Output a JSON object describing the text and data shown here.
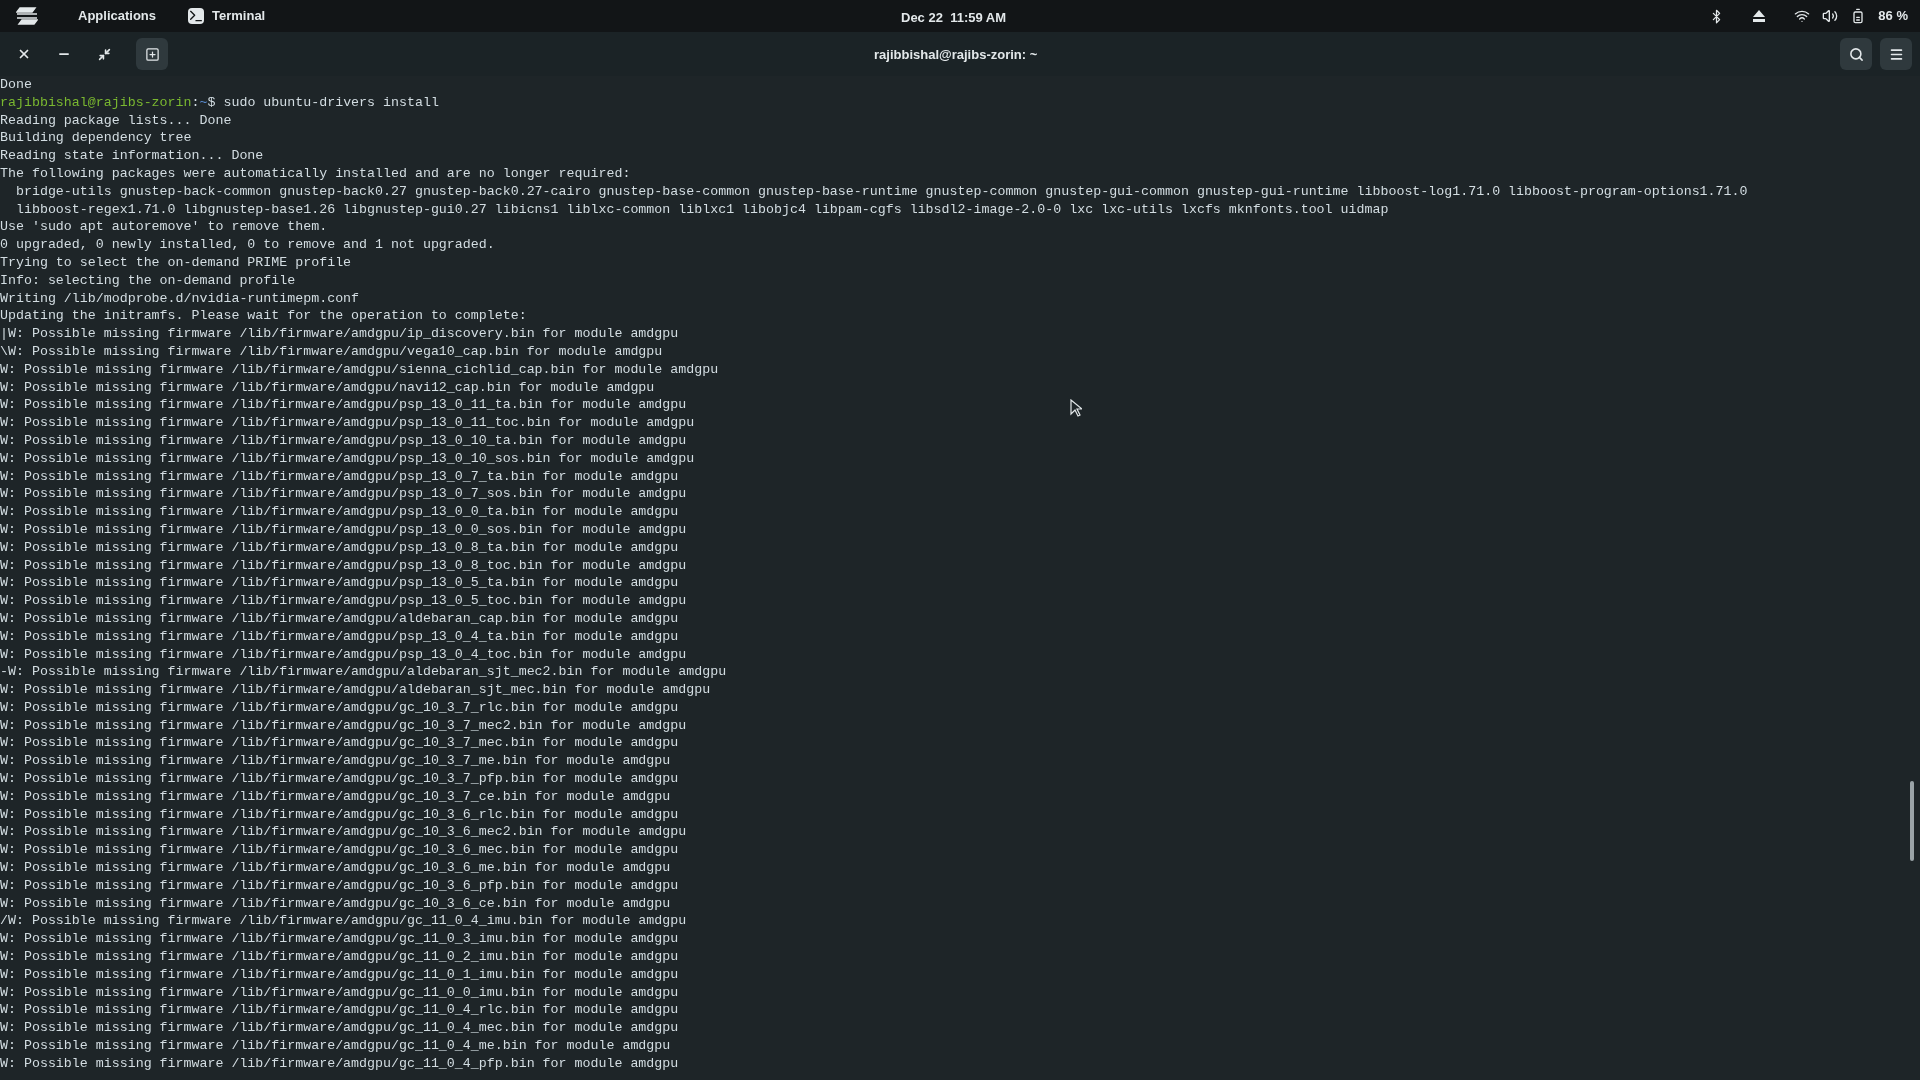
{
  "top_bar": {
    "menu": "Applications",
    "app": "Terminal",
    "clock": "Dec 22  11:59 AM",
    "battery": "86 %"
  },
  "window": {
    "title": "rajibbishal@rajibs-zorin: ~"
  },
  "terminal": {
    "lines": [
      {
        "kind": "output",
        "text": "Done"
      },
      {
        "kind": "prompt",
        "user_host": "rajibbishal@rajibs-zorin",
        "separator": ":",
        "path": "~",
        "command": "$ sudo ubuntu-drivers install"
      },
      {
        "kind": "output",
        "text": "Reading package lists... Done"
      },
      {
        "kind": "output",
        "text": "Building dependency tree"
      },
      {
        "kind": "output",
        "text": "Reading state information... Done"
      },
      {
        "kind": "output",
        "text": "The following packages were automatically installed and are no longer required:"
      },
      {
        "kind": "output",
        "text": "  bridge-utils gnustep-back-common gnustep-back0.27 gnustep-back0.27-cairo gnustep-base-common gnustep-base-runtime gnustep-common gnustep-gui-common gnustep-gui-runtime libboost-log1.71.0 libboost-program-options1.71.0"
      },
      {
        "kind": "output",
        "text": "  libboost-regex1.71.0 libgnustep-base1.26 libgnustep-gui0.27 libicns1 liblxc-common liblxc1 libobjc4 libpam-cgfs libsdl2-image-2.0-0 lxc lxc-utils lxcfs mknfonts.tool uidmap"
      },
      {
        "kind": "output",
        "text": "Use 'sudo apt autoremove' to remove them."
      },
      {
        "kind": "output",
        "text": "0 upgraded, 0 newly installed, 0 to remove and 1 not upgraded."
      },
      {
        "kind": "output",
        "text": "Trying to select the on-demand PRIME profile"
      },
      {
        "kind": "output",
        "text": "Info: selecting the on-demand profile"
      },
      {
        "kind": "output",
        "text": "Writing /lib/modprobe.d/nvidia-runtimepm.conf"
      },
      {
        "kind": "output",
        "text": "Updating the initramfs. Please wait for the operation to complete:"
      },
      {
        "kind": "output",
        "text": "|W: Possible missing firmware /lib/firmware/amdgpu/ip_discovery.bin for module amdgpu"
      },
      {
        "kind": "output",
        "text": "\\W: Possible missing firmware /lib/firmware/amdgpu/vega10_cap.bin for module amdgpu"
      },
      {
        "kind": "output",
        "text": "W: Possible missing firmware /lib/firmware/amdgpu/sienna_cichlid_cap.bin for module amdgpu"
      },
      {
        "kind": "output",
        "text": "W: Possible missing firmware /lib/firmware/amdgpu/navi12_cap.bin for module amdgpu"
      },
      {
        "kind": "output",
        "text": "W: Possible missing firmware /lib/firmware/amdgpu/psp_13_0_11_ta.bin for module amdgpu"
      },
      {
        "kind": "output",
        "text": "W: Possible missing firmware /lib/firmware/amdgpu/psp_13_0_11_toc.bin for module amdgpu"
      },
      {
        "kind": "output",
        "text": "W: Possible missing firmware /lib/firmware/amdgpu/psp_13_0_10_ta.bin for module amdgpu"
      },
      {
        "kind": "output",
        "text": "W: Possible missing firmware /lib/firmware/amdgpu/psp_13_0_10_sos.bin for module amdgpu"
      },
      {
        "kind": "output",
        "text": "W: Possible missing firmware /lib/firmware/amdgpu/psp_13_0_7_ta.bin for module amdgpu"
      },
      {
        "kind": "output",
        "text": "W: Possible missing firmware /lib/firmware/amdgpu/psp_13_0_7_sos.bin for module amdgpu"
      },
      {
        "kind": "output",
        "text": "W: Possible missing firmware /lib/firmware/amdgpu/psp_13_0_0_ta.bin for module amdgpu"
      },
      {
        "kind": "output",
        "text": "W: Possible missing firmware /lib/firmware/amdgpu/psp_13_0_0_sos.bin for module amdgpu"
      },
      {
        "kind": "output",
        "text": "W: Possible missing firmware /lib/firmware/amdgpu/psp_13_0_8_ta.bin for module amdgpu"
      },
      {
        "kind": "output",
        "text": "W: Possible missing firmware /lib/firmware/amdgpu/psp_13_0_8_toc.bin for module amdgpu"
      },
      {
        "kind": "output",
        "text": "W: Possible missing firmware /lib/firmware/amdgpu/psp_13_0_5_ta.bin for module amdgpu"
      },
      {
        "kind": "output",
        "text": "W: Possible missing firmware /lib/firmware/amdgpu/psp_13_0_5_toc.bin for module amdgpu"
      },
      {
        "kind": "output",
        "text": "W: Possible missing firmware /lib/firmware/amdgpu/aldebaran_cap.bin for module amdgpu"
      },
      {
        "kind": "output",
        "text": "W: Possible missing firmware /lib/firmware/amdgpu/psp_13_0_4_ta.bin for module amdgpu"
      },
      {
        "kind": "output",
        "text": "W: Possible missing firmware /lib/firmware/amdgpu/psp_13_0_4_toc.bin for module amdgpu"
      },
      {
        "kind": "output",
        "text": "-W: Possible missing firmware /lib/firmware/amdgpu/aldebaran_sjt_mec2.bin for module amdgpu"
      },
      {
        "kind": "output",
        "text": "W: Possible missing firmware /lib/firmware/amdgpu/aldebaran_sjt_mec.bin for module amdgpu"
      },
      {
        "kind": "output",
        "text": "W: Possible missing firmware /lib/firmware/amdgpu/gc_10_3_7_rlc.bin for module amdgpu"
      },
      {
        "kind": "output",
        "text": "W: Possible missing firmware /lib/firmware/amdgpu/gc_10_3_7_mec2.bin for module amdgpu"
      },
      {
        "kind": "output",
        "text": "W: Possible missing firmware /lib/firmware/amdgpu/gc_10_3_7_mec.bin for module amdgpu"
      },
      {
        "kind": "output",
        "text": "W: Possible missing firmware /lib/firmware/amdgpu/gc_10_3_7_me.bin for module amdgpu"
      },
      {
        "kind": "output",
        "text": "W: Possible missing firmware /lib/firmware/amdgpu/gc_10_3_7_pfp.bin for module amdgpu"
      },
      {
        "kind": "output",
        "text": "W: Possible missing firmware /lib/firmware/amdgpu/gc_10_3_7_ce.bin for module amdgpu"
      },
      {
        "kind": "output",
        "text": "W: Possible missing firmware /lib/firmware/amdgpu/gc_10_3_6_rlc.bin for module amdgpu"
      },
      {
        "kind": "output",
        "text": "W: Possible missing firmware /lib/firmware/amdgpu/gc_10_3_6_mec2.bin for module amdgpu"
      },
      {
        "kind": "output",
        "text": "W: Possible missing firmware /lib/firmware/amdgpu/gc_10_3_6_mec.bin for module amdgpu"
      },
      {
        "kind": "output",
        "text": "W: Possible missing firmware /lib/firmware/amdgpu/gc_10_3_6_me.bin for module amdgpu"
      },
      {
        "kind": "output",
        "text": "W: Possible missing firmware /lib/firmware/amdgpu/gc_10_3_6_pfp.bin for module amdgpu"
      },
      {
        "kind": "output",
        "text": "W: Possible missing firmware /lib/firmware/amdgpu/gc_10_3_6_ce.bin for module amdgpu"
      },
      {
        "kind": "output",
        "text": "/W: Possible missing firmware /lib/firmware/amdgpu/gc_11_0_4_imu.bin for module amdgpu"
      },
      {
        "kind": "output",
        "text": "W: Possible missing firmware /lib/firmware/amdgpu/gc_11_0_3_imu.bin for module amdgpu"
      },
      {
        "kind": "output",
        "text": "W: Possible missing firmware /lib/firmware/amdgpu/gc_11_0_2_imu.bin for module amdgpu"
      },
      {
        "kind": "output",
        "text": "W: Possible missing firmware /lib/firmware/amdgpu/gc_11_0_1_imu.bin for module amdgpu"
      },
      {
        "kind": "output",
        "text": "W: Possible missing firmware /lib/firmware/amdgpu/gc_11_0_0_imu.bin for module amdgpu"
      },
      {
        "kind": "output",
        "text": "W: Possible missing firmware /lib/firmware/amdgpu/gc_11_0_4_rlc.bin for module amdgpu"
      },
      {
        "kind": "output",
        "text": "W: Possible missing firmware /lib/firmware/amdgpu/gc_11_0_4_mec.bin for module amdgpu"
      },
      {
        "kind": "output",
        "text": "W: Possible missing firmware /lib/firmware/amdgpu/gc_11_0_4_me.bin for module amdgpu"
      },
      {
        "kind": "output",
        "text": "W: Possible missing firmware /lib/firmware/amdgpu/gc_11_0_4_pfp.bin for module amdgpu"
      }
    ]
  }
}
